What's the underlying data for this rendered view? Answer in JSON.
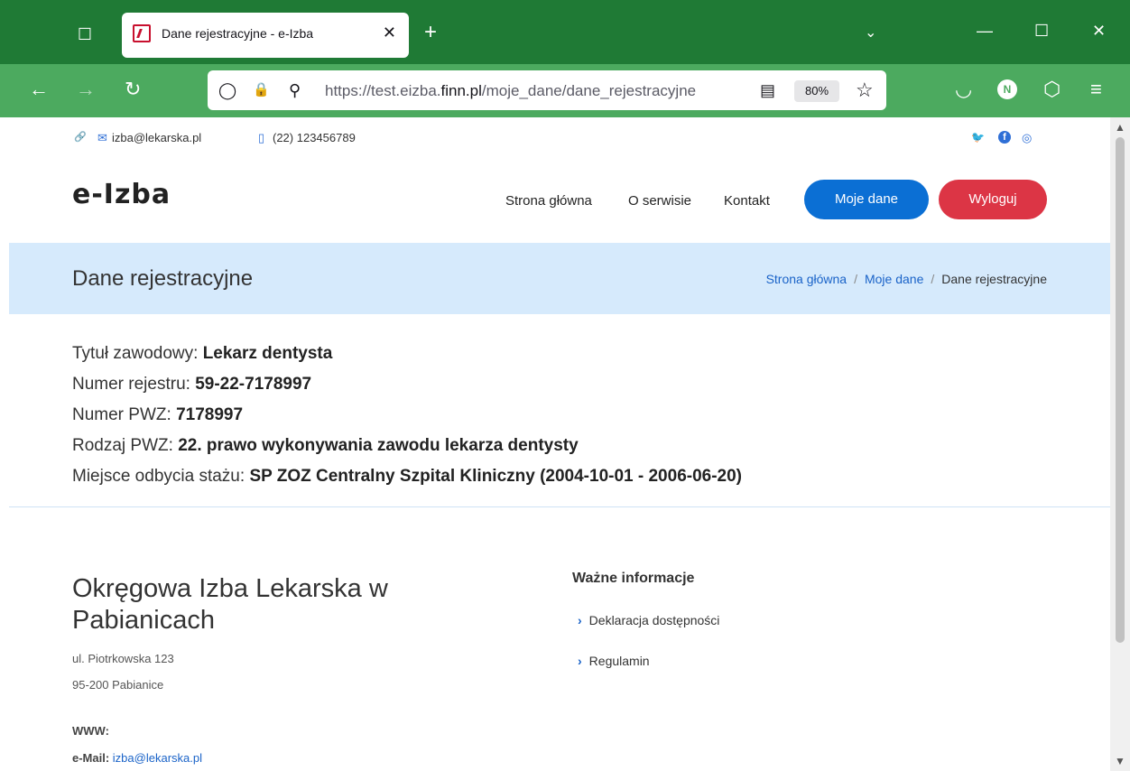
{
  "browser": {
    "tab_title": "Dane rejestracyjne - e-Izba",
    "url_prefix": "https://test.eizba.",
    "url_domain": "finn.pl",
    "url_path": "/moje_dane/dane_rejestracyjne",
    "zoom": "80%",
    "account_initial": "N",
    "icons": {
      "tab_list": "☐",
      "close": "✕",
      "new_tab": "+",
      "list_all": "⌄",
      "minimize": "—",
      "maximize": "☐",
      "window_close": "✕",
      "back": "←",
      "forward": "→",
      "reload": "↻",
      "shield": "◯",
      "lock": "🔒",
      "permissions": "⚲",
      "reader": "▤",
      "star": "☆",
      "pocket": "◡",
      "extensions": "⬡",
      "menu": "≡"
    }
  },
  "topbar": {
    "email": "izba@lekarska.pl",
    "phone": "(22) 123456789",
    "icons": {
      "link": "🔗",
      "mail": "✉",
      "phone": "▯",
      "twitter": "🐦",
      "facebook": "f",
      "instagram": "◎"
    }
  },
  "header": {
    "logo": "e-Izba",
    "nav": [
      "Strona główna",
      "O serwisie",
      "Kontakt"
    ],
    "my_data_button": "Moje dane",
    "logout_button": "Wyloguj"
  },
  "page": {
    "title": "Dane rejestracyjne",
    "breadcrumb": [
      "Strona główna",
      "Moje dane",
      "Dane rejestracyjne"
    ],
    "breadcrumb_sep": "/",
    "fields": [
      {
        "label": "Tytuł zawodowy:",
        "value": "Lekarz dentysta"
      },
      {
        "label": "Numer rejestru:",
        "value": "59-22-7178997"
      },
      {
        "label": "Numer PWZ:",
        "value": "7178997"
      },
      {
        "label": "Rodzaj PWZ:",
        "value": "22. prawo wykonywania zawodu lekarza dentysty"
      },
      {
        "label": "Miejsce odbycia stażu:",
        "value": "SP ZOZ Centralny Szpital Kliniczny (2004-10-01 - 2006-06-20)"
      }
    ]
  },
  "footer": {
    "org_name": "Okręgowa Izba Lekarska w Pabianicach",
    "street": "ul. Piotrkowska 123",
    "city": "95-200 Pabianice",
    "www_label": "WWW:",
    "email_label": "e-Mail:",
    "email_value": "izba@lekarska.pl",
    "info_heading": "Ważne informacje",
    "info_links": [
      "Deklaracja dostępności",
      "Regulamin"
    ],
    "chevron": "›"
  }
}
